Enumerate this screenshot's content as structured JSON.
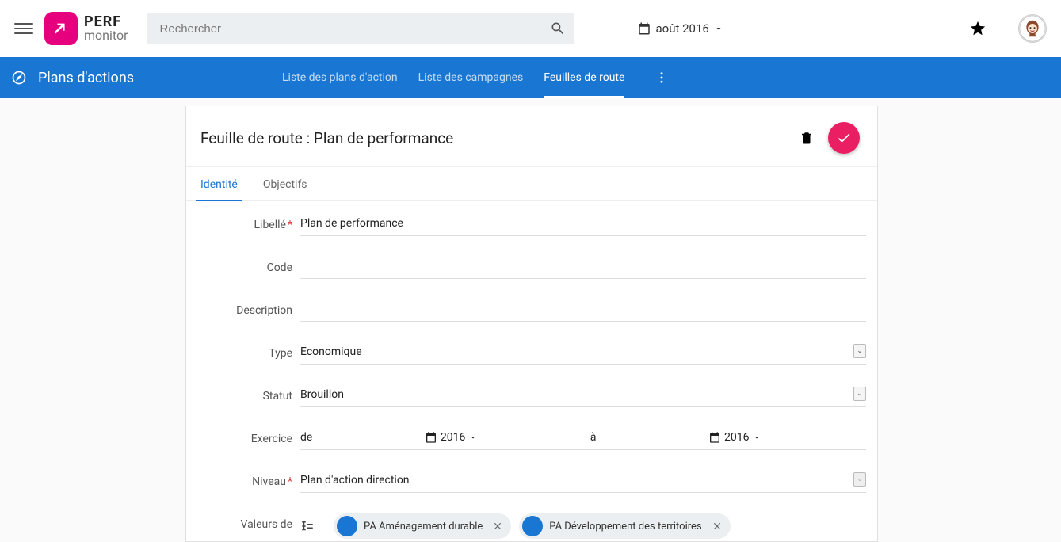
{
  "app": {
    "name_line1": "PERF",
    "name_line2": "monitor",
    "search_placeholder": "Rechercher",
    "period_label": "août 2016"
  },
  "section": {
    "title": "Plans d'actions",
    "tabs": [
      {
        "label": "Liste des plans d'action"
      },
      {
        "label": "Liste des campagnes"
      },
      {
        "label": "Feuilles de route",
        "active": true
      }
    ]
  },
  "page": {
    "title": "Feuille de route : Plan de performance",
    "tabs": [
      {
        "label": "Identité",
        "active": true
      },
      {
        "label": "Objectifs"
      }
    ],
    "form": {
      "libelle": {
        "label": "Libellé",
        "value": "Plan de performance"
      },
      "code": {
        "label": "Code",
        "value": ""
      },
      "description": {
        "label": "Description",
        "value": ""
      },
      "type": {
        "label": "Type",
        "value": "Economique"
      },
      "statut": {
        "label": "Statut",
        "value": "Brouillon"
      },
      "exercice": {
        "label": "Exercice",
        "from_word": "de",
        "from_year": "2016",
        "to_word": "à",
        "to_year": "2016"
      },
      "niveau": {
        "label": "Niveau",
        "value": "Plan d'action direction"
      },
      "valeurs": {
        "label": "Valeurs de",
        "chips": [
          {
            "label": "PA Aménagement durable"
          },
          {
            "label": "PA Développement des territoires"
          }
        ]
      }
    }
  }
}
